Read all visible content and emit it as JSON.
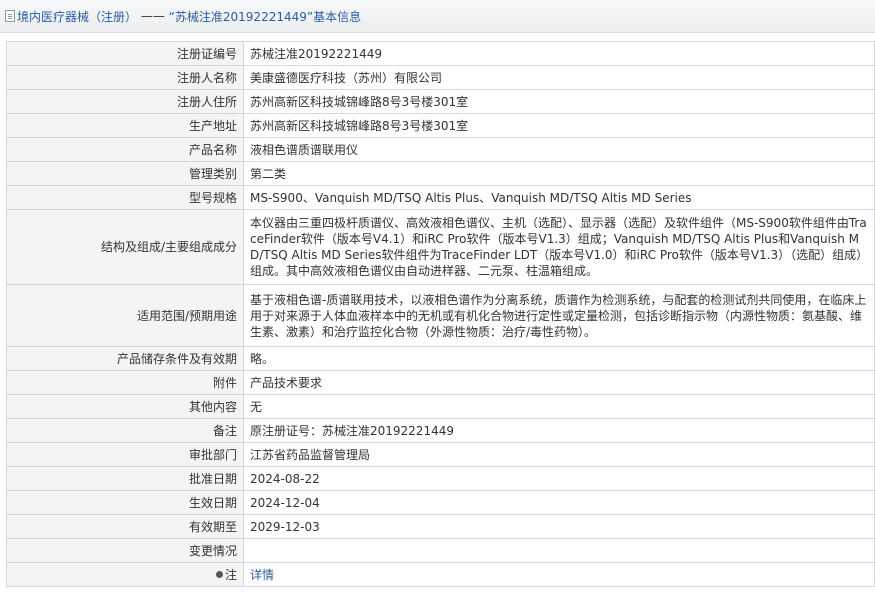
{
  "breadcrumb": {
    "link": "境内医疗器械（注册）",
    "separator": "——",
    "title": "“苏械注准20192221449”基本信息"
  },
  "rows": [
    {
      "label": "注册证编号",
      "value": "苏械注准20192221449"
    },
    {
      "label": "注册人名称",
      "value": "美康盛德医疗科技（苏州）有限公司"
    },
    {
      "label": "注册人住所",
      "value": "苏州高新区科技城锦峰路8号3号楼301室"
    },
    {
      "label": "生产地址",
      "value": "苏州高新区科技城锦峰路8号3号楼301室"
    },
    {
      "label": "产品名称",
      "value": "液相色谱质谱联用仪"
    },
    {
      "label": "管理类别",
      "value": "第二类"
    },
    {
      "label": "型号规格",
      "value": "MS-S900、Vanquish MD/TSQ Altis Plus、Vanquish MD/TSQ Altis MD Series"
    },
    {
      "label": "结构及组成/主要组成成分",
      "value": "本仪器由三重四极杆质谱仪、高效液相色谱仪、主机（选配）、显示器（选配）及软件组件（MS-S900软件组件由TraceFinder软件（版本号V4.1）和iRC Pro软件（版本号V1.3）组成；Vanquish MD/TSQ Altis Plus和Vanquish MD/TSQ Altis MD Series软件组件为TraceFinder LDT（版本号V1.0）和iRC Pro软件（版本号V1.3）（选配）组成）组成。其中高效液相色谱仪由自动进样器、二元泵、柱温箱组成。"
    },
    {
      "label": "适用范围/预期用途",
      "value": "基于液相色谱-质谱联用技术，以液相色谱作为分离系统，质谱作为检测系统，与配套的检测试剂共同使用，在临床上用于对来源于人体血液样本中的无机或有机化合物进行定性或定量检测，包括诊断指示物（内源性物质：氨基酸、维生素、激素）和治疗监控化合物（外源性物质：治疗/毒性药物）。"
    },
    {
      "label": "产品储存条件及有效期",
      "value": "略。"
    },
    {
      "label": "附件",
      "value": "产品技术要求"
    },
    {
      "label": "其他内容",
      "value": "无"
    },
    {
      "label": "备注",
      "value": "原注册证号：苏械注准20192221449"
    },
    {
      "label": "审批部门",
      "value": "江苏省药品监督管理局"
    },
    {
      "label": "批准日期",
      "value": "2024-08-22"
    },
    {
      "label": "生效日期",
      "value": "2024-12-04"
    },
    {
      "label": "有效期至",
      "value": "2029-12-03"
    },
    {
      "label": "变更情况",
      "value": ""
    }
  ],
  "note": {
    "icon": "lightbulb-icon",
    "label": "注",
    "link": "详情"
  },
  "colors": {
    "link": "#2a5caa",
    "label_bg": "#f2f4f6",
    "border": "#d4d8dd"
  }
}
